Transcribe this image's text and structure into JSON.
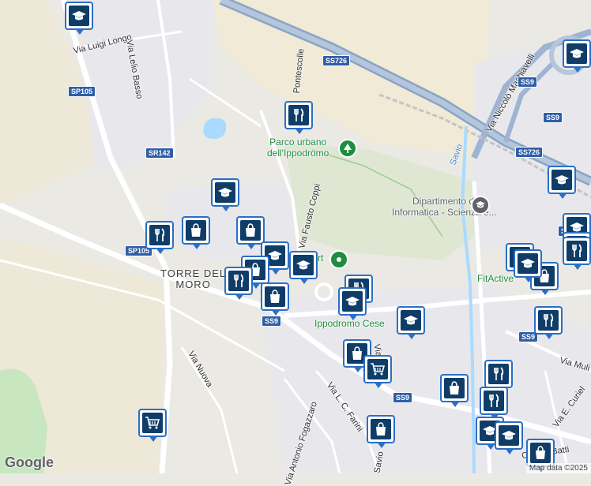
{
  "map": {
    "colors": {
      "background": "#ebe9e4",
      "park": "#c8e6c0",
      "water": "#aadaff",
      "highway": "#8aa4c6",
      "road": "#ffffff",
      "pin_border": "#2b6ec6",
      "pin_fill": "#0f3d68",
      "poi_green": "#1e8e3e",
      "poi_gray": "#5f6368"
    },
    "street_labels": [
      "Via Luigi Longo",
      "Via Lelio Basso",
      "Pontescolle",
      "Via Fausto Coppi",
      "Via Nuova",
      "Via Antonio Fogazzaro",
      "Via L. C. Farini",
      "Via Niccolò Machiavelli",
      "Via Muli",
      "Via E. Curiel",
      "Cesare Batti",
      "Savio",
      "Via",
      "Savio"
    ],
    "route_shields": [
      "SS726",
      "SP105",
      "SR142",
      "SP105",
      "SS9",
      "SS9",
      "SS9",
      "SS726",
      "SS9",
      "SS9",
      "SS9"
    ],
    "places": [
      {
        "name": "Parco urbano dell'Ippodromo",
        "line1": "Parco urbano",
        "line2": "dell'Ippodromo",
        "type": "park"
      },
      {
        "name": "Dipartimento di Informatica - Scienza e...",
        "line1": "Dipartimento di",
        "line2": "Informatica - Scienza e...",
        "type": "school"
      },
      {
        "name": "TORRE DEL MORO",
        "line1": "TORRE DEL",
        "line2": "MORO",
        "type": "area"
      },
      {
        "name": "Ippodromo Cese",
        "line1": "Ippodromo Cese",
        "line2": "",
        "type": "venue"
      },
      {
        "name": "FitActive",
        "line1": "FitActive",
        "line2": "",
        "type": "gym"
      },
      {
        "name": "rt",
        "line1": "rt",
        "line2": "",
        "type": "venue"
      }
    ],
    "pins": [
      {
        "kind": "school",
        "label": "school-pin"
      },
      {
        "kind": "restaurant",
        "label": "restaurant-pin"
      },
      {
        "kind": "school",
        "label": "school-pin"
      },
      {
        "kind": "shopping",
        "label": "shopping-pin"
      },
      {
        "kind": "restaurant",
        "label": "restaurant-pin"
      },
      {
        "kind": "shopping",
        "label": "shopping-pin"
      },
      {
        "kind": "school",
        "label": "school-pin"
      },
      {
        "kind": "shopping",
        "label": "shopping-pin"
      },
      {
        "kind": "school",
        "label": "school-pin"
      },
      {
        "kind": "restaurant",
        "label": "restaurant-pin"
      },
      {
        "kind": "shopping",
        "label": "shopping-pin"
      },
      {
        "kind": "restaurant",
        "label": "restaurant-pin"
      },
      {
        "kind": "school",
        "label": "school-pin"
      },
      {
        "kind": "school",
        "label": "school-pin"
      },
      {
        "kind": "shopping",
        "label": "shopping-pin"
      },
      {
        "kind": "grocery",
        "label": "grocery-pin"
      },
      {
        "kind": "shopping",
        "label": "shopping-pin"
      },
      {
        "kind": "grocery",
        "label": "grocery-pin"
      },
      {
        "kind": "shopping",
        "label": "shopping-pin"
      },
      {
        "kind": "restaurant",
        "label": "restaurant-pin"
      },
      {
        "kind": "restaurant",
        "label": "restaurant-pin"
      },
      {
        "kind": "restaurant",
        "label": "restaurant-pin"
      },
      {
        "kind": "school",
        "label": "school-pin"
      },
      {
        "kind": "school",
        "label": "school-pin"
      },
      {
        "kind": "school",
        "label": "school-pin"
      },
      {
        "kind": "school",
        "label": "school-pin"
      },
      {
        "kind": "school",
        "label": "school-pin"
      },
      {
        "kind": "shopping",
        "label": "shopping-pin"
      },
      {
        "kind": "restaurant",
        "label": "restaurant-pin"
      },
      {
        "kind": "restaurant",
        "label": "restaurant-pin"
      },
      {
        "kind": "restaurant",
        "label": "restaurant-pin"
      },
      {
        "kind": "school",
        "label": "school-pin"
      },
      {
        "kind": "shopping",
        "label": "shopping-pin"
      }
    ],
    "logo_text": "Google",
    "attribution": "Map data ©2025"
  }
}
